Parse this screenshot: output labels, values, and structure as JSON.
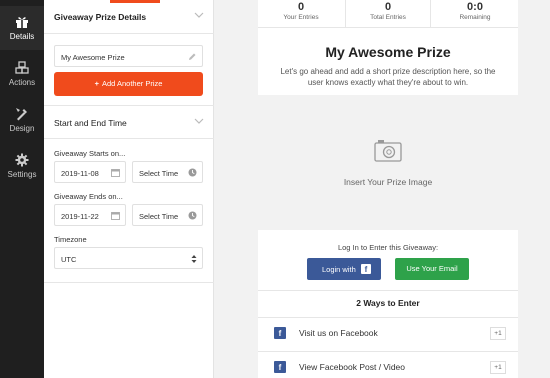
{
  "nav": {
    "items": [
      {
        "label": "Details",
        "icon": "gift-icon"
      },
      {
        "label": "Actions",
        "icon": "cubes-icon"
      },
      {
        "label": "Design",
        "icon": "paint-icon"
      },
      {
        "label": "Settings",
        "icon": "gear-icon"
      }
    ]
  },
  "panel": {
    "prize_section_title": "Giveaway Prize Details",
    "prize_name": "My Awesome Prize",
    "add_prize_label": "Add Another Prize",
    "time_section_title": "Start and End Time",
    "starts_label": "Giveaway Starts on...",
    "start_date": "2019-11-08",
    "start_time_placeholder": "Select Time",
    "ends_label": "Giveaway Ends on...",
    "end_date": "2019-11-22",
    "end_time_placeholder": "Select Time",
    "timezone_label": "Timezone",
    "timezone_value": "UTC"
  },
  "preview": {
    "stats": [
      {
        "value": "0",
        "label": "Your Entries"
      },
      {
        "value": "0",
        "label": "Total Entries"
      },
      {
        "value": "0:0",
        "label": "Remaining"
      }
    ],
    "prize_title": "My Awesome Prize",
    "prize_description": "Let's go ahead and add a short prize description here, so the user knows exactly what they're about to win.",
    "image_placeholder": "Insert Your Prize Image",
    "login_caption": "Log In to Enter this Giveaway:",
    "login_facebook_label": "Login with",
    "email_label": "Use Your Email",
    "ways_title": "2 Ways to Enter",
    "entries": [
      {
        "label": "Visit us on Facebook",
        "points": "+1"
      },
      {
        "label": "View Facebook Post / Video",
        "points": "+1"
      }
    ]
  },
  "colors": {
    "accent": "#f04b1c",
    "facebook": "#3b5998",
    "email_green": "#2ea24a",
    "nav_bg": "#1f1f1f"
  }
}
